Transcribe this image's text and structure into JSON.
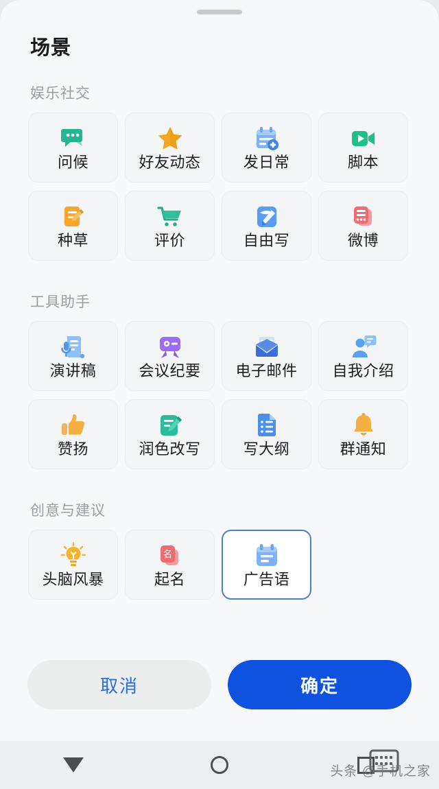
{
  "sheet": {
    "title": "场景",
    "drag_handle": "drag-handle"
  },
  "sections": [
    {
      "title": "娱乐社交",
      "items": [
        {
          "label": "问候",
          "icon": "chat-bubble-icon",
          "color": "#25b18a",
          "selected": false
        },
        {
          "label": "好友动态",
          "icon": "star-icon",
          "color": "#f5a623",
          "selected": false
        },
        {
          "label": "发日常",
          "icon": "calendar-plus-icon",
          "color": "#6ba4f0",
          "selected": false
        },
        {
          "label": "脚本",
          "icon": "video-camera-icon",
          "color": "#1ec08a",
          "selected": false
        },
        {
          "label": "种草",
          "icon": "note-pen-icon",
          "color": "#f7a62b",
          "selected": false
        },
        {
          "label": "评价",
          "icon": "shopping-cart-icon",
          "color": "#23b08c",
          "selected": false
        },
        {
          "label": "自由写",
          "icon": "free-write-icon",
          "color": "#5a9cf2",
          "selected": false
        },
        {
          "label": "微博",
          "icon": "weibo-card-icon",
          "color": "#ef6b72",
          "selected": false
        }
      ]
    },
    {
      "title": "工具助手",
      "items": [
        {
          "label": "演讲稿",
          "icon": "scroll-mic-icon",
          "color": "#63a4ef",
          "selected": false
        },
        {
          "label": "会议纪要",
          "icon": "meeting-badge-icon",
          "color": "#9d6cf0",
          "selected": false
        },
        {
          "label": "电子邮件",
          "icon": "envelope-icon",
          "color": "#3b6fd6",
          "selected": false
        },
        {
          "label": "自我介绍",
          "icon": "person-speech-icon",
          "color": "#57a3ef",
          "selected": false
        },
        {
          "label": "赞扬",
          "icon": "thumbs-up-icon",
          "color": "#f5b041",
          "selected": false
        },
        {
          "label": "润色改写",
          "icon": "doc-pen-icon",
          "color": "#2ebb9a",
          "selected": false
        },
        {
          "label": "写大纲",
          "icon": "outline-doc-icon",
          "color": "#4c8fe8",
          "selected": false
        },
        {
          "label": "群通知",
          "icon": "bell-icon",
          "color": "#f5b041",
          "selected": false
        }
      ]
    },
    {
      "title": "创意与建议",
      "items": [
        {
          "label": "头脑风暴",
          "icon": "lightbulb-icon",
          "color": "#f7b32b",
          "selected": false
        },
        {
          "label": "起名",
          "icon": "name-card-icon",
          "color": "#ef6b72",
          "selected": false
        },
        {
          "label": "广告语",
          "icon": "calendar-lines-icon",
          "color": "#6ba4f0",
          "selected": true
        }
      ]
    }
  ],
  "footer": {
    "cancel_label": "取消",
    "confirm_label": "确定"
  },
  "navbar": {
    "back": "back-icon",
    "home": "home-icon",
    "recents": "recents-icon",
    "keyboard": "keyboard-icon"
  },
  "watermark": "头条 @手机之家",
  "colors": {
    "accent": "#0f52e0",
    "selected_border": "#4a7fd0",
    "sheet_bg": "#f7f8fa",
    "card_bg": "#f4f5f7",
    "section_title": "#9b9da2",
    "cancel_text": "#2b6de0"
  }
}
